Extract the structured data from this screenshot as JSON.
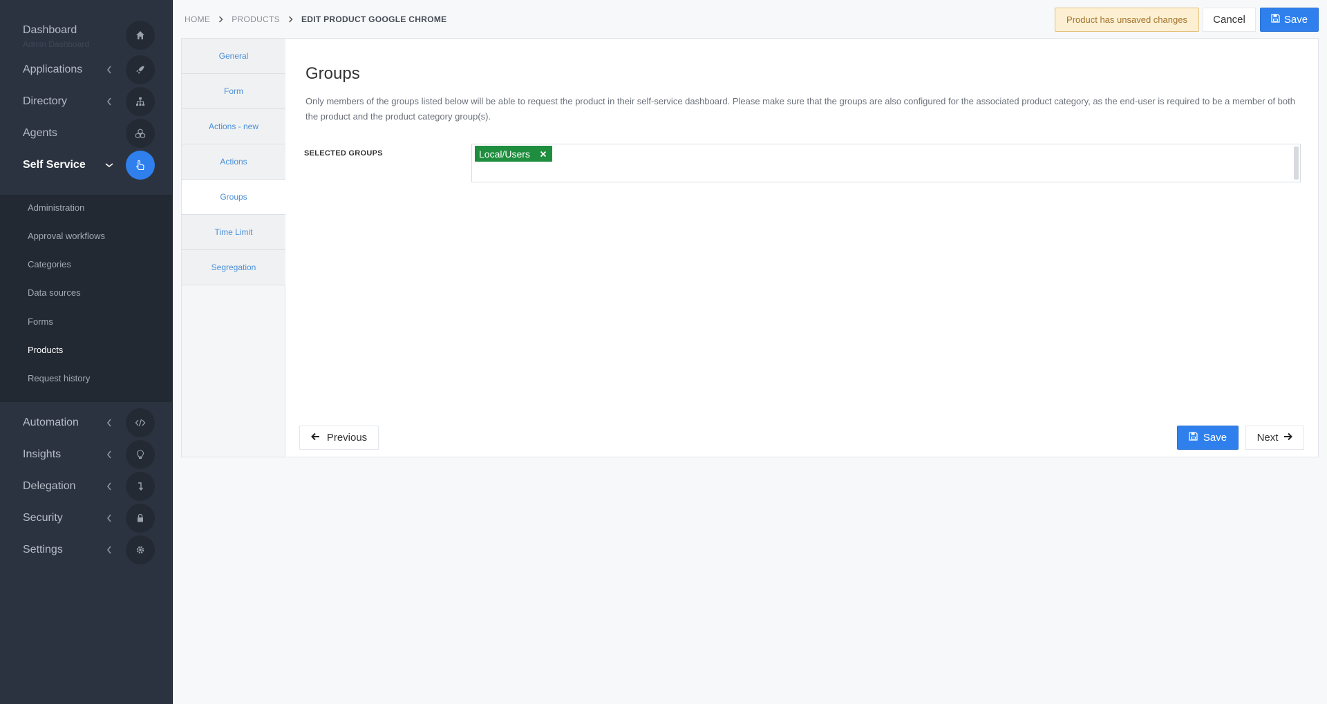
{
  "sidebar": {
    "dashboard": {
      "label": "Dashboard",
      "sublabel": "Admin Dashboard",
      "icon": "home-icon"
    },
    "items": [
      {
        "label": "Applications",
        "icon": "rocket-icon",
        "expanded": false
      },
      {
        "label": "Directory",
        "icon": "sitemap-icon",
        "expanded": false
      },
      {
        "label": "Agents",
        "icon": "cubes-icon",
        "expanded": false
      },
      {
        "label": "Self Service",
        "icon": "hand-pointer-icon",
        "expanded": true
      },
      {
        "label": "Automation",
        "icon": "code-icon",
        "expanded": false
      },
      {
        "label": "Insights",
        "icon": "lightbulb-icon",
        "expanded": false
      },
      {
        "label": "Delegation",
        "icon": "level-down-icon",
        "expanded": false
      },
      {
        "label": "Security",
        "icon": "lock-icon",
        "expanded": false
      },
      {
        "label": "Settings",
        "icon": "gear-icon",
        "expanded": false
      }
    ],
    "self_service_submenu": [
      {
        "label": "Administration"
      },
      {
        "label": "Approval workflows"
      },
      {
        "label": "Categories"
      },
      {
        "label": "Data sources"
      },
      {
        "label": "Forms"
      },
      {
        "label": "Products",
        "active": true
      },
      {
        "label": "Request history"
      }
    ]
  },
  "breadcrumb": {
    "home": "HOME",
    "products": "PRODUCTS",
    "current": "EDIT PRODUCT GOOGLE CHROME"
  },
  "header": {
    "unsaved_notice": "Product has unsaved changes",
    "cancel_label": "Cancel",
    "save_label": "Save"
  },
  "tabs": [
    {
      "label": "General"
    },
    {
      "label": "Form"
    },
    {
      "label": "Actions - new"
    },
    {
      "label": "Actions"
    },
    {
      "label": "Groups",
      "active": true
    },
    {
      "label": "Time Limit"
    },
    {
      "label": "Segregation"
    }
  ],
  "groups_section": {
    "title": "Groups",
    "description": "Only members of the groups listed below will be able to request the product in their self-service dashboard. Please make sure that the groups are also configured for the associated product category, as the end-user is required to be a member of both the product and the product category group(s).",
    "selected_label": "SELECTED GROUPS",
    "selected_groups": [
      "Local/Users"
    ]
  },
  "footer": {
    "previous_label": "Previous",
    "save_label": "Save",
    "next_label": "Next"
  },
  "colors": {
    "accent": "#2f80ed",
    "sidebar_bg": "#2c3340",
    "tag_green": "#1e8e3e",
    "warning_bg": "#fdf0d2",
    "link": "#4a90d9"
  }
}
